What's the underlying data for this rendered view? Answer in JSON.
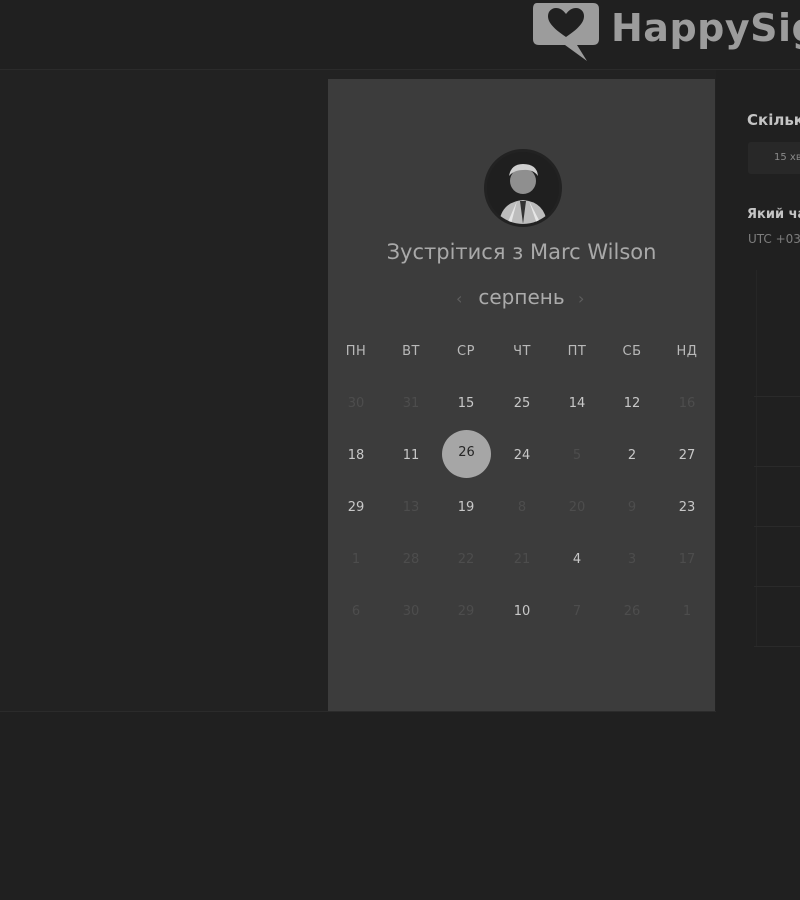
{
  "app": {
    "logo_text": "HappySig"
  },
  "scheduler": {
    "title": "Зустрітися з Marc Wilson",
    "month": "серпень",
    "prev_icon": "chevron-left-icon",
    "next_icon": "chevron-right-icon",
    "weekdays": [
      "ПН",
      "ВТ",
      "СР",
      "ЧТ",
      "ПТ",
      "СБ",
      "НД"
    ],
    "selected_day": "26",
    "weeks": [
      [
        {
          "label": "30",
          "available": false
        },
        {
          "label": "31",
          "available": false
        },
        {
          "label": "15",
          "available": true
        },
        {
          "label": "25",
          "available": true
        },
        {
          "label": "14",
          "available": true
        },
        {
          "label": "12",
          "available": true
        },
        {
          "label": "16",
          "available": false
        }
      ],
      [
        {
          "label": "18",
          "available": true
        },
        {
          "label": "11",
          "available": true
        },
        {
          "label": "",
          "available": false
        },
        {
          "label": "24",
          "available": true
        },
        {
          "label": "5",
          "available": false
        },
        {
          "label": "2",
          "available": true
        },
        {
          "label": "27",
          "available": true
        }
      ],
      [
        {
          "label": "29",
          "available": true
        },
        {
          "label": "13",
          "available": false
        },
        {
          "label": "19",
          "available": true
        },
        {
          "label": "8",
          "available": false
        },
        {
          "label": "20",
          "available": false
        },
        {
          "label": "9",
          "available": false
        },
        {
          "label": "23",
          "available": true
        }
      ],
      [
        {
          "label": "1",
          "available": false
        },
        {
          "label": "28",
          "available": false
        },
        {
          "label": "22",
          "available": false
        },
        {
          "label": "21",
          "available": false
        },
        {
          "label": "4",
          "available": true
        },
        {
          "label": "3",
          "available": false
        },
        {
          "label": "17",
          "available": false
        }
      ],
      [
        {
          "label": "6",
          "available": false
        },
        {
          "label": "30",
          "available": false
        },
        {
          "label": "29",
          "available": false
        },
        {
          "label": "10",
          "available": true
        },
        {
          "label": "7",
          "available": false
        },
        {
          "label": "26",
          "available": false
        },
        {
          "label": "1",
          "available": false
        }
      ]
    ]
  },
  "sidebar_right": {
    "duration_label": "Скільки",
    "duration_value": "15 хв",
    "time_label": "Який ча",
    "timezone": "UTC +03"
  },
  "colors": {
    "background": "#202020",
    "panel": "#3c3c3c",
    "selected": "#a6a6a6"
  }
}
